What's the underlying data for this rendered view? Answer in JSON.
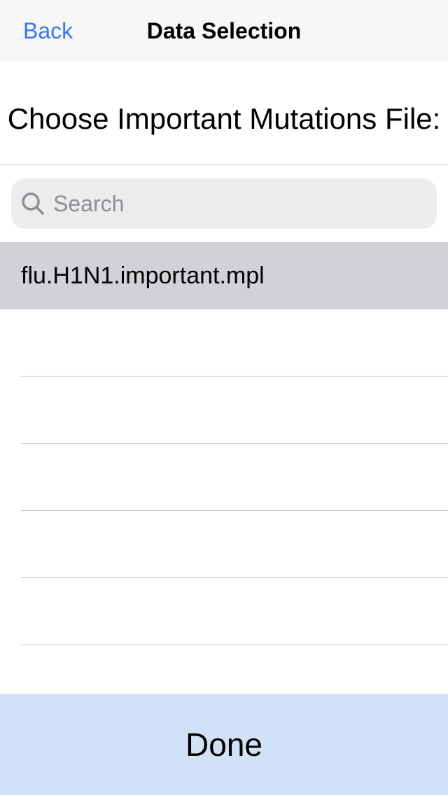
{
  "nav": {
    "back_label": "Back",
    "title": "Data Selection"
  },
  "prompt": "Choose Important Mutations File:",
  "search": {
    "placeholder": "Search",
    "value": ""
  },
  "files": [
    {
      "label": "flu.H1N1.important.mpl",
      "selected": true
    },
    {
      "label": ""
    },
    {
      "label": ""
    },
    {
      "label": ""
    },
    {
      "label": ""
    },
    {
      "label": ""
    }
  ],
  "done_label": "Done",
  "colors": {
    "accent": "#3478f6",
    "selected_row": "#d1d1d6",
    "done_background": "#d1e2f8"
  }
}
